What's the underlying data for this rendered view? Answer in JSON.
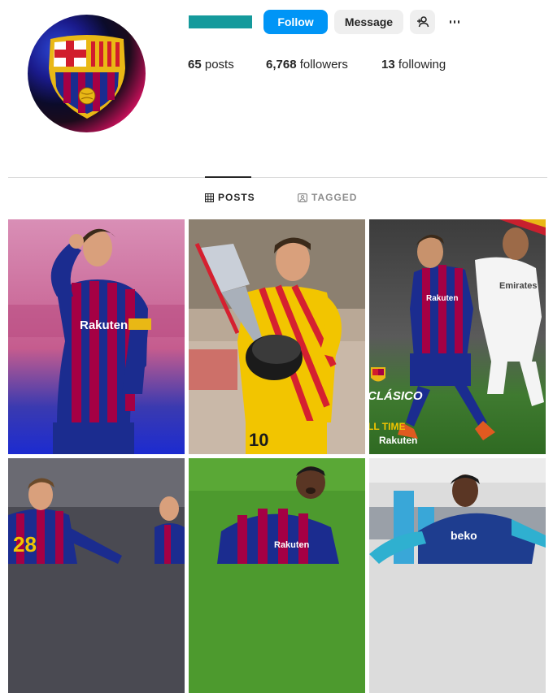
{
  "profile": {
    "avatar_icon": "fc-barcelona-crest-icon",
    "buttons": {
      "follow": "Follow",
      "message": "Message",
      "suggest_icon": "add-person-icon",
      "more_icon": "more-options-icon"
    },
    "stats": {
      "posts_count": "65",
      "posts_label": "posts",
      "followers_count": "6,768",
      "followers_label": "followers",
      "following_count": "13",
      "following_label": "following"
    }
  },
  "tabs": [
    {
      "label": "POSTS",
      "icon": "grid-icon",
      "active": true
    },
    {
      "label": "TAGGED",
      "icon": "tagged-icon",
      "active": false
    }
  ],
  "posts": [
    {
      "description": "Player in blaugrana kit with hand on head",
      "sponsor": "Rakuten"
    },
    {
      "description": "Player in yellow kit holding trophy",
      "number": "10"
    },
    {
      "description": "Clasico match action",
      "caption_1": "CLÁSICO",
      "caption_2": "LL TIME",
      "sponsor": "Rakuten",
      "opponent_sponsor": "Emirates"
    },
    {
      "description": "Players in blaugrana kit at night",
      "number": "28"
    },
    {
      "description": "Player celebrating on grass",
      "sponsor": "Rakuten"
    },
    {
      "description": "Player in training kit",
      "sponsor": "beko"
    }
  ],
  "colors": {
    "follow_button": "#0095f6",
    "username_redaction": "#159a9c",
    "secondary_button": "#efefef",
    "divider": "#dbdbdb"
  }
}
